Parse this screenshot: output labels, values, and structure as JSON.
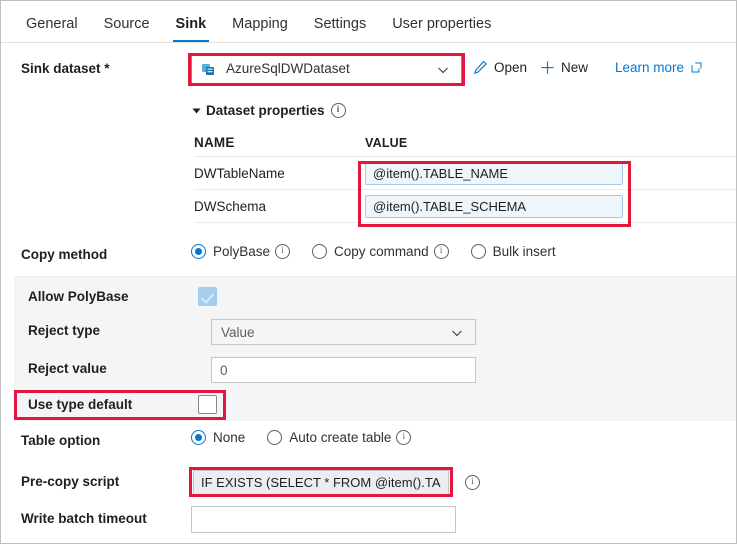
{
  "tabs": [
    {
      "label": "General",
      "active": false
    },
    {
      "label": "Source",
      "active": false
    },
    {
      "label": "Sink",
      "active": true
    },
    {
      "label": "Mapping",
      "active": false
    },
    {
      "label": "Settings",
      "active": false
    },
    {
      "label": "User properties",
      "active": false
    }
  ],
  "sink_dataset": {
    "label": "Sink dataset",
    "required_marker": "*",
    "selected_value": "AzureSqlDWDataset",
    "icon": "dataset-icon",
    "chevron": "chevron-down-icon",
    "open_label": "Open",
    "open_icon": "pencil-icon",
    "new_label": "New",
    "new_icon": "plus-icon",
    "learn_more_label": "Learn more",
    "learn_more_icon": "external-link-icon"
  },
  "dataset_properties": {
    "header": "Dataset properties",
    "expanded_icon": "triangle-down-icon",
    "info_icon": "info-icon",
    "columns": [
      "NAME",
      "VALUE"
    ],
    "rows": [
      {
        "name": "DWTableName",
        "value": "@item().TABLE_NAME"
      },
      {
        "name": "DWSchema",
        "value": "@item().TABLE_SCHEMA"
      }
    ]
  },
  "copy_method": {
    "label": "Copy method",
    "options": [
      {
        "label": "PolyBase",
        "selected": true,
        "info": true
      },
      {
        "label": "Copy command",
        "selected": false,
        "info": true
      },
      {
        "label": "Bulk insert",
        "selected": false,
        "info": false
      }
    ]
  },
  "polybase_panel": {
    "allow_polybase": {
      "label": "Allow PolyBase",
      "checked": true
    },
    "reject_type": {
      "label": "Reject type",
      "value": "Value",
      "chevron": "chevron-down-icon"
    },
    "reject_value": {
      "label": "Reject value",
      "value": "0"
    },
    "use_type_default": {
      "label": "Use type default",
      "checked": false
    }
  },
  "table_option": {
    "label": "Table option",
    "options": [
      {
        "label": "None",
        "selected": true,
        "info": false
      },
      {
        "label": "Auto create table",
        "selected": false,
        "info": true
      }
    ]
  },
  "pre_copy_script": {
    "label": "Pre-copy script",
    "value": "IF EXISTS (SELECT * FROM @item().TA...",
    "info_icon": "info-icon"
  },
  "write_batch_timeout": {
    "label": "Write batch timeout",
    "value": ""
  },
  "highlight_color": "#e3173e",
  "accent_color": "#0078d4"
}
